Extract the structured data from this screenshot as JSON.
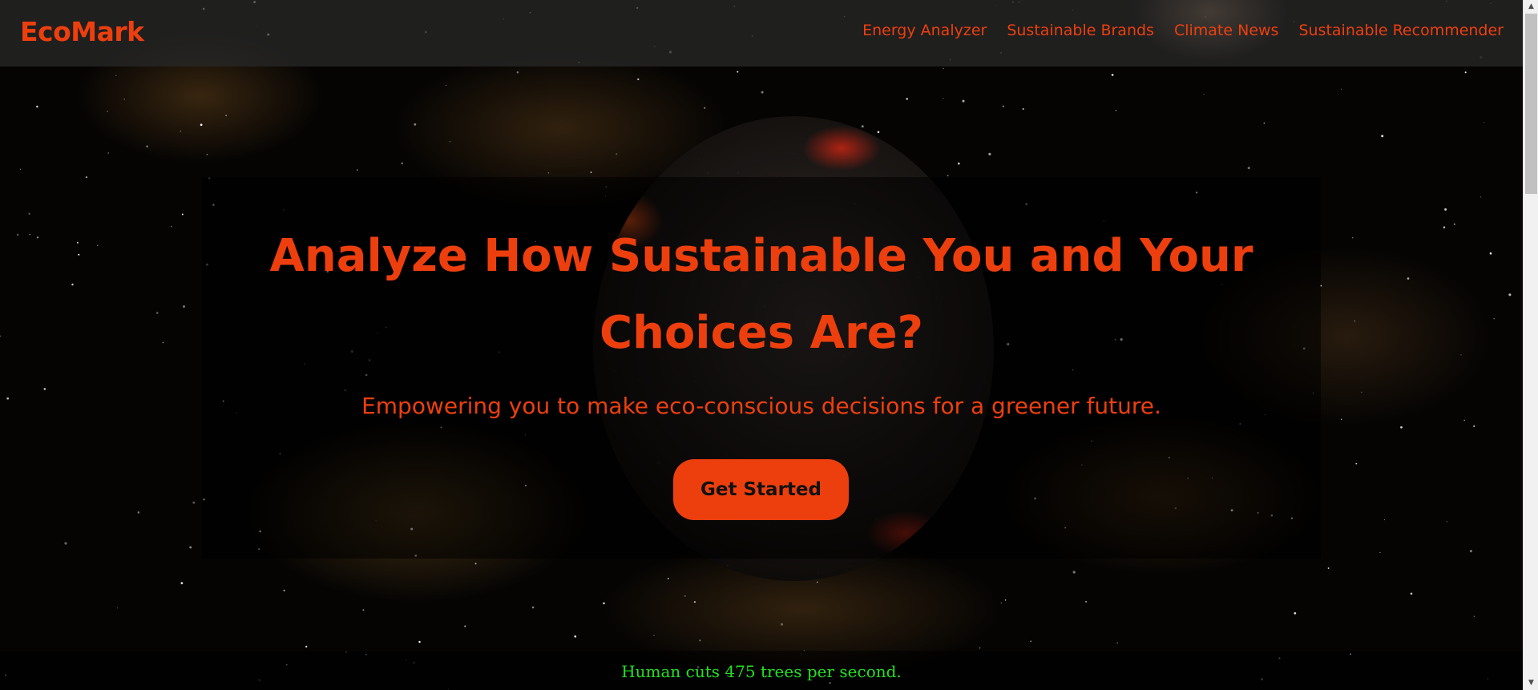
{
  "navbar": {
    "logo": "EcoMark",
    "links": [
      {
        "label": "Energy Analyzer"
      },
      {
        "label": "Sustainable Brands"
      },
      {
        "label": "Climate News"
      },
      {
        "label": "Sustainable Recommender"
      }
    ]
  },
  "hero": {
    "title": "Analyze How Sustainable You and Your Choices Are?",
    "subtitle": "Empowering you to make eco-conscious decisions for a greener future.",
    "cta_label": "Get Started"
  },
  "fact": "Human cuts 475 trees per second.",
  "colors": {
    "accent": "#ed3f0e",
    "fact_text": "#22e022",
    "background": "#050403"
  },
  "icons": {
    "scroll_up": "triangle-up-icon",
    "scroll_down": "triangle-down-icon"
  }
}
